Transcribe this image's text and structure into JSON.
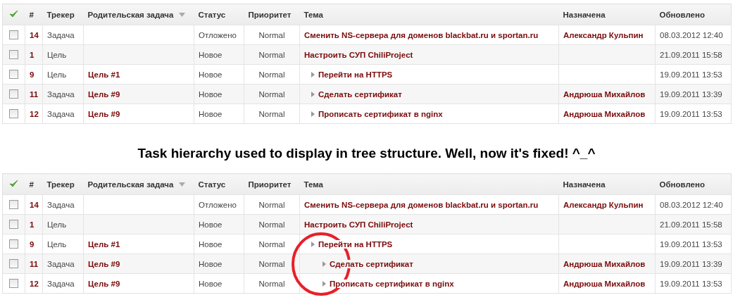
{
  "flat_table": {
    "columns": [
      {
        "label": "#"
      },
      {
        "label": "Трекер"
      },
      {
        "label": "Родительская задача",
        "sorted": true
      },
      {
        "label": "Статус"
      },
      {
        "label": "Приоритет"
      },
      {
        "label": "Тема"
      },
      {
        "label": "Назначена"
      },
      {
        "label": "Обновлено"
      }
    ],
    "rows": [
      {
        "checked": false,
        "id": "14",
        "tracker": "Задача",
        "status": "Отложено",
        "priority": "Normal",
        "subject": "Сменить NS-сервера для доменов blackbat.ru и sportan.ru",
        "subtask": false,
        "assignee": "Александр Кульпин",
        "updated": "08.03.2012 12:40"
      },
      {
        "checked": false,
        "id": "1",
        "tracker": "Цель",
        "status": "Новое",
        "priority": "Normal",
        "subject": "Настроить СУП ChiliProject",
        "subtask": false,
        "updated": "21.09.2011 15:58"
      },
      {
        "checked": false,
        "id": "9",
        "tracker": "Цель",
        "parent": "Цель #1",
        "status": "Новое",
        "priority": "Normal",
        "subject": "Перейти на HTTPS",
        "subtask": true,
        "updated": "19.09.2011 13:53"
      },
      {
        "checked": false,
        "id": "11",
        "tracker": "Задача",
        "parent": "Цель #9",
        "status": "Новое",
        "priority": "Normal",
        "subject": "Сделать сертификат",
        "subtask": true,
        "assignee": "Андрюша Михайлов",
        "updated": "19.09.2011 13:39"
      },
      {
        "checked": false,
        "id": "12",
        "tracker": "Задача",
        "parent": "Цель #9",
        "status": "Новое",
        "priority": "Normal",
        "subject": "Прописать сертификат в nginx",
        "subtask": true,
        "assignee": "Андрюша Михайлов",
        "updated": "19.09.2011 13:53"
      }
    ]
  },
  "caption": "Task hierarchy used to display in tree structure. Well, now it's fixed! ^_^",
  "tree_table": {
    "columns": [
      {
        "label": "#"
      },
      {
        "label": "Трекер"
      },
      {
        "label": "Родительская задача",
        "sorted": true
      },
      {
        "label": "Статус"
      },
      {
        "label": "Приоритет"
      },
      {
        "label": "Тема"
      },
      {
        "label": "Назначена"
      },
      {
        "label": "Обновлено"
      }
    ],
    "rows": [
      {
        "checked": false,
        "id": "14",
        "tracker": "Задача",
        "status": "Отложено",
        "priority": "Normal",
        "subject": "Сменить NS-сервера для доменов blackbat.ru и sportan.ru",
        "assignee": "Александр Кульпин",
        "updated": "08.03.2012 12:40"
      },
      {
        "checked": false,
        "id": "1",
        "tracker": "Цель",
        "status": "Новое",
        "priority": "Normal",
        "subject": "Настроить СУП ChiliProject",
        "updated": "21.09.2011 15:58",
        "children": [
          {
            "checked": false,
            "id": "9",
            "tracker": "Цель",
            "parent": "Цель #1",
            "status": "Новое",
            "priority": "Normal",
            "subject": "Перейти на HTTPS",
            "updated": "19.09.2011 13:53",
            "children": [
              {
                "checked": false,
                "id": "11",
                "tracker": "Задача",
                "parent": "Цель #9",
                "status": "Новое",
                "priority": "Normal",
                "subject": "Сделать сертификат",
                "assignee": "Андрюша Михайлов",
                "updated": "19.09.2011 13:39"
              },
              {
                "checked": false,
                "id": "12",
                "tracker": "Задача",
                "parent": "Цель #9",
                "status": "Новое",
                "priority": "Normal",
                "subject": "Прописать сертификат в nginx",
                "assignee": "Андрюша Михайлов",
                "updated": "19.09.2011 13:53"
              }
            ]
          }
        ]
      }
    ]
  }
}
